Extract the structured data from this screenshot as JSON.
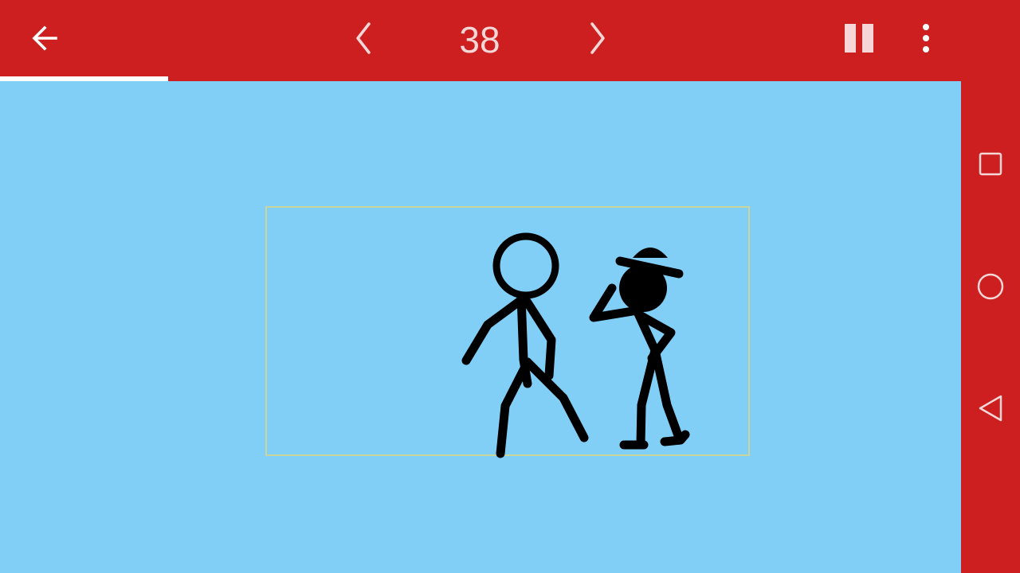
{
  "toolbar": {
    "back_icon": "arrow-left-icon",
    "prev_icon": "chevron-left-icon",
    "frame_number": "38",
    "next_icon": "chevron-right-icon",
    "pause_icon": "pause-icon",
    "more_icon": "more-vertical-icon",
    "playback_progress": 0.175
  },
  "stage": {
    "background_color": "#81CFF7",
    "frame_border_color": "#C9D79E",
    "figures": [
      "stick-figure",
      "stick-figure-with-cap"
    ]
  },
  "navbar": {
    "recents_icon": "square-icon",
    "home_icon": "circle-icon",
    "back_icon": "triangle-back-icon"
  },
  "colors": {
    "accent": "#CD1F1F",
    "icon": "#FFFFFF"
  }
}
